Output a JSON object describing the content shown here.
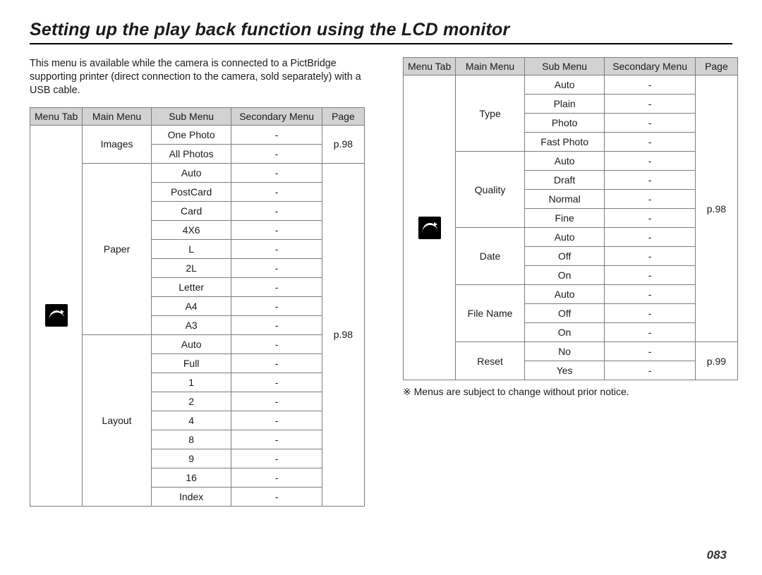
{
  "title": "Setting up the play back function using the LCD monitor",
  "intro": "This menu is available while the camera is connected to a PictBridge supporting printer (direct connection to the camera, sold separately) with a USB cable.",
  "headers": {
    "menu_tab": "Menu Tab",
    "main_menu": "Main Menu",
    "sub_menu": "Sub Menu",
    "secondary_menu": "Secondary Menu",
    "page": "Page"
  },
  "left": {
    "page_ref": "p.98",
    "groups": [
      {
        "main": "Images",
        "page": "p.98",
        "subs": [
          "One Photo",
          "All Photos"
        ]
      },
      {
        "main": "Paper",
        "subs": [
          "Auto",
          "PostCard",
          "Card",
          "4X6",
          "L",
          "2L",
          "Letter",
          "A4",
          "A3"
        ]
      },
      {
        "main": "Layout",
        "subs": [
          "Auto",
          "Full",
          "1",
          "2",
          "4",
          "8",
          "9",
          "16",
          "Index"
        ]
      }
    ]
  },
  "right": {
    "page_ref_top": "p.98",
    "page_ref_bottom": "p.99",
    "groups": [
      {
        "main": "Type",
        "subs": [
          "Auto",
          "Plain",
          "Photo",
          "Fast Photo"
        ]
      },
      {
        "main": "Quality",
        "subs": [
          "Auto",
          "Draft",
          "Normal",
          "Fine"
        ]
      },
      {
        "main": "Date",
        "subs": [
          "Auto",
          "Off",
          "On"
        ]
      },
      {
        "main": "File Name",
        "subs": [
          "Auto",
          "Off",
          "On"
        ]
      },
      {
        "main": "Reset",
        "subs": [
          "No",
          "Yes"
        ]
      }
    ]
  },
  "note": "※  Menus are subject to change without prior notice.",
  "dash": "-",
  "page_number": "083"
}
